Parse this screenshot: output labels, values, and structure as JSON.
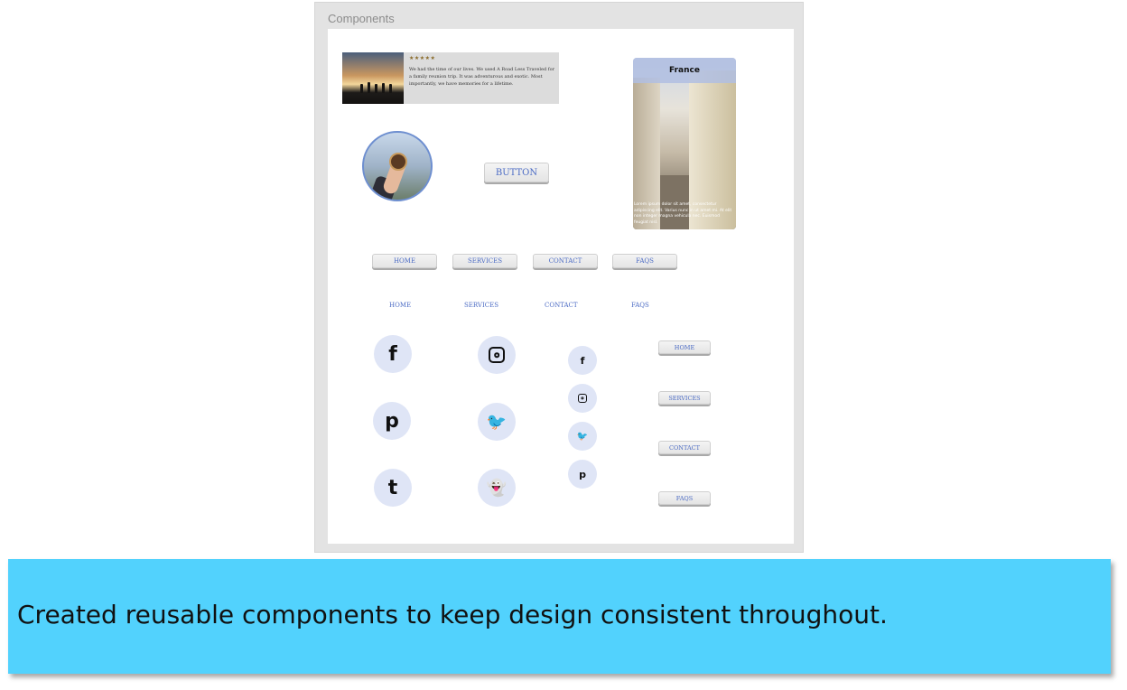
{
  "frame": {
    "title": "Components"
  },
  "review_card": {
    "stars": "★★★★★",
    "text": "We had the time of our lives. We used A Road Less Traveled for a family reunion trip. It was adventurous and exotic. Most importantly, we have memories for a lifetime."
  },
  "destination_card": {
    "title": "France",
    "text": "Lorem ipsum dolor sit amet, consectetur adipiscing elit. Varius nunc in ut amet mi. At elit non integer magna vehicula nec. Euismod feugiat nisl."
  },
  "button": {
    "label": "BUTTON"
  },
  "nav_buttons": [
    "HOME",
    "SERVICES",
    "CONTACT",
    "FAQS"
  ],
  "nav_links": [
    "HOME",
    "SERVICES",
    "CONTACT",
    "FAQS"
  ],
  "side_buttons": [
    "HOME",
    "SERVICES",
    "CONTACT",
    "FAQS"
  ],
  "social_large": [
    {
      "name": "facebook-icon",
      "glyph": "f"
    },
    {
      "name": "instagram-icon",
      "glyph": ""
    },
    {
      "name": "pinterest-icon",
      "glyph": "p"
    },
    {
      "name": "twitter-icon",
      "glyph": "🐦"
    },
    {
      "name": "tumblr-icon",
      "glyph": "t"
    },
    {
      "name": "snapchat-icon",
      "glyph": "👻"
    }
  ],
  "social_small": [
    {
      "name": "facebook-icon",
      "glyph": "f"
    },
    {
      "name": "instagram-icon",
      "glyph": ""
    },
    {
      "name": "twitter-icon",
      "glyph": "🐦"
    },
    {
      "name": "pinterest-icon",
      "glyph": "p"
    }
  ],
  "colors": {
    "banner": "#52d2fd",
    "accent": "#4b6bc4",
    "icon_bg": "#dfe5f6"
  },
  "caption": "Created reusable components to keep design consistent throughout."
}
